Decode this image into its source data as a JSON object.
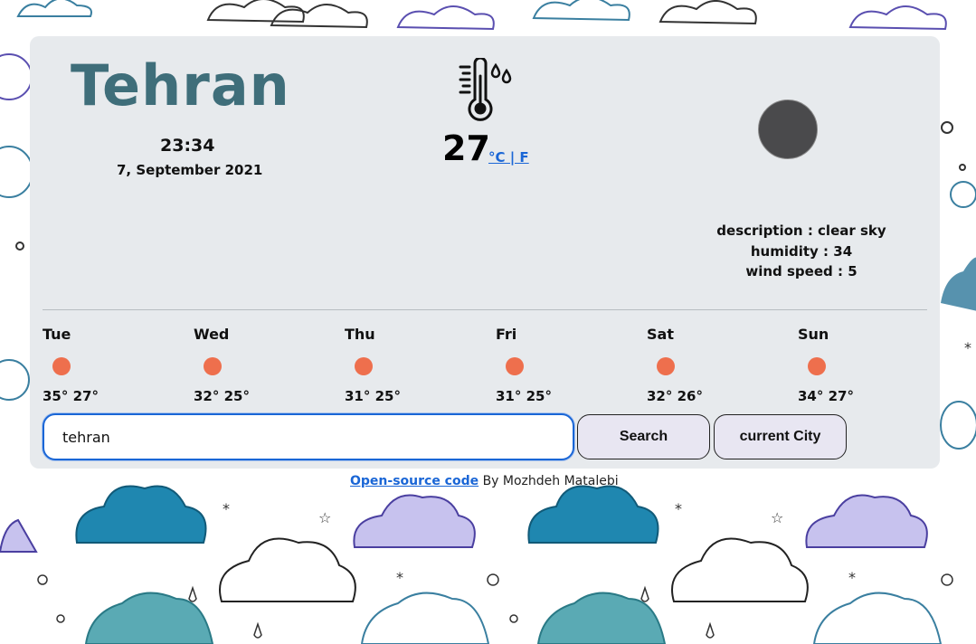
{
  "weather": {
    "city": "Tehran",
    "time": "23:34",
    "date": "7, September 2021",
    "temperature": "27",
    "units_label": "°C | F",
    "description": "description : clear sky",
    "humidity": "humidity : 34",
    "wind": "wind speed : 5"
  },
  "forecast": [
    {
      "day": "Tue",
      "temps": "35° 27°"
    },
    {
      "day": "Wed",
      "temps": "32° 25°"
    },
    {
      "day": "Thu",
      "temps": "31° 25°"
    },
    {
      "day": "Fri",
      "temps": "31° 25°"
    },
    {
      "day": "Sat",
      "temps": "32° 26°"
    },
    {
      "day": "Sun",
      "temps": "34° 27°"
    }
  ],
  "search": {
    "value": "tehran",
    "search_label": "Search",
    "current_label": "current City"
  },
  "footer": {
    "link_text": "Open-source code",
    "author_text": " By Mozhdeh Matalebi"
  },
  "colors": {
    "card": "#e7eaed",
    "city": "#3f6e7a",
    "sun": "#ee6f4d",
    "link": "#1a66d6"
  },
  "icons": {
    "thermometer": "thermometer-icon",
    "weather": "weather-icon",
    "forecast": "sun-icon"
  }
}
